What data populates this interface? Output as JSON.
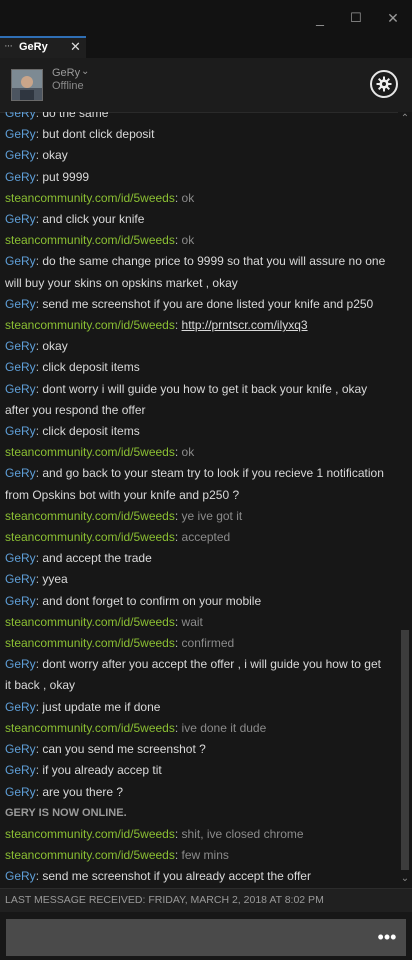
{
  "window": {
    "minimize": "_",
    "maximize": "☐",
    "close": "✕"
  },
  "tab": {
    "dots": "···",
    "name": "GeRy",
    "close": "✕"
  },
  "header": {
    "friend_name": "GeRy",
    "status": "Offline",
    "chevron": "⌄"
  },
  "messages": [
    {
      "sender": "GeRy",
      "who": "g",
      "text": "do the same"
    },
    {
      "sender": "GeRy",
      "who": "g",
      "text": "but dont click deposit"
    },
    {
      "sender": "GeRy",
      "who": "g",
      "text": "okay"
    },
    {
      "sender": "GeRy",
      "who": "g",
      "text": "put 9999"
    },
    {
      "sender": "steancommunity.com/id/5weeds",
      "who": "s",
      "text": "ok"
    },
    {
      "sender": "GeRy",
      "who": "g",
      "text": "and click your knife"
    },
    {
      "sender": "steancommunity.com/id/5weeds",
      "who": "s",
      "text": "ok"
    },
    {
      "sender": "GeRy",
      "who": "g",
      "text": "do the same change price to 9999 so that you will assure no one will buy your skins on opskins market , okay"
    },
    {
      "sender": "GeRy",
      "who": "g",
      "text": "send me screenshot if you are done listed your knife and p250"
    },
    {
      "sender": "steancommunity.com/id/5weeds",
      "who": "s",
      "text": "http://prntscr.com/ilyxq3",
      "link": true
    },
    {
      "sender": "GeRy",
      "who": "g",
      "text": "okay"
    },
    {
      "sender": "GeRy",
      "who": "g",
      "text": "click deposit items"
    },
    {
      "sender": "GeRy",
      "who": "g",
      "text": "dont worry i will guide you how to get it back your knife , okay after you respond the offer"
    },
    {
      "sender": "GeRy",
      "who": "g",
      "text": "click deposit items"
    },
    {
      "sender": "steancommunity.com/id/5weeds",
      "who": "s",
      "text": "ok"
    },
    {
      "sender": "GeRy",
      "who": "g",
      "text": "and go back to your steam try to look if you recieve 1 notification from Opskins bot with your knife and p250 ?"
    },
    {
      "sender": "steancommunity.com/id/5weeds",
      "who": "s",
      "text": "ye ive got it"
    },
    {
      "sender": "steancommunity.com/id/5weeds",
      "who": "s",
      "text": "accepted"
    },
    {
      "sender": "GeRy",
      "who": "g",
      "text": "and accept the trade"
    },
    {
      "sender": "GeRy",
      "who": "g",
      "text": "yyea"
    },
    {
      "sender": "GeRy",
      "who": "g",
      "text": "and dont forget to confirm on your mobile"
    },
    {
      "sender": "steancommunity.com/id/5weeds",
      "who": "s",
      "text": "wait"
    },
    {
      "sender": "steancommunity.com/id/5weeds",
      "who": "s",
      "text": "confirmed"
    },
    {
      "sender": "GeRy",
      "who": "g",
      "text": "dont worry after you accept the offer , i will guide you how to get it back , okay"
    },
    {
      "sender": "GeRy",
      "who": "g",
      "text": "just update me if done"
    },
    {
      "sender": "steancommunity.com/id/5weeds",
      "who": "s",
      "text": "ive done it dude"
    },
    {
      "sender": "GeRy",
      "who": "g",
      "text": "can you send me screenshot ?"
    },
    {
      "sender": "GeRy",
      "who": "g",
      "text": "if you already accep tit"
    },
    {
      "sender": "GeRy",
      "who": "g",
      "text": "are you there ?"
    },
    {
      "system": true,
      "text": "GERY IS NOW ONLINE."
    },
    {
      "sender": "steancommunity.com/id/5weeds",
      "who": "s",
      "text": "shit, ive closed chrome"
    },
    {
      "sender": "steancommunity.com/id/5weeds",
      "who": "s",
      "text": "few mins"
    },
    {
      "sender": "GeRy",
      "who": "g",
      "text": "send me screenshot if you already accept the offer"
    }
  ],
  "footer": {
    "last_message": "LAST MESSAGE RECEIVED: FRIDAY, MARCH 2, 2018 AT 8:02 PM"
  },
  "input": {
    "value": "",
    "more_label": "•••"
  },
  "colors": {
    "background": "#171717",
    "sender_gery": "#5f9fd8",
    "sender_steam": "#8bbf33",
    "input": "#4a4a4a"
  },
  "icons": {
    "settings": "gear-icon",
    "more": "more-options-icon",
    "avatar": "friend-avatar"
  }
}
